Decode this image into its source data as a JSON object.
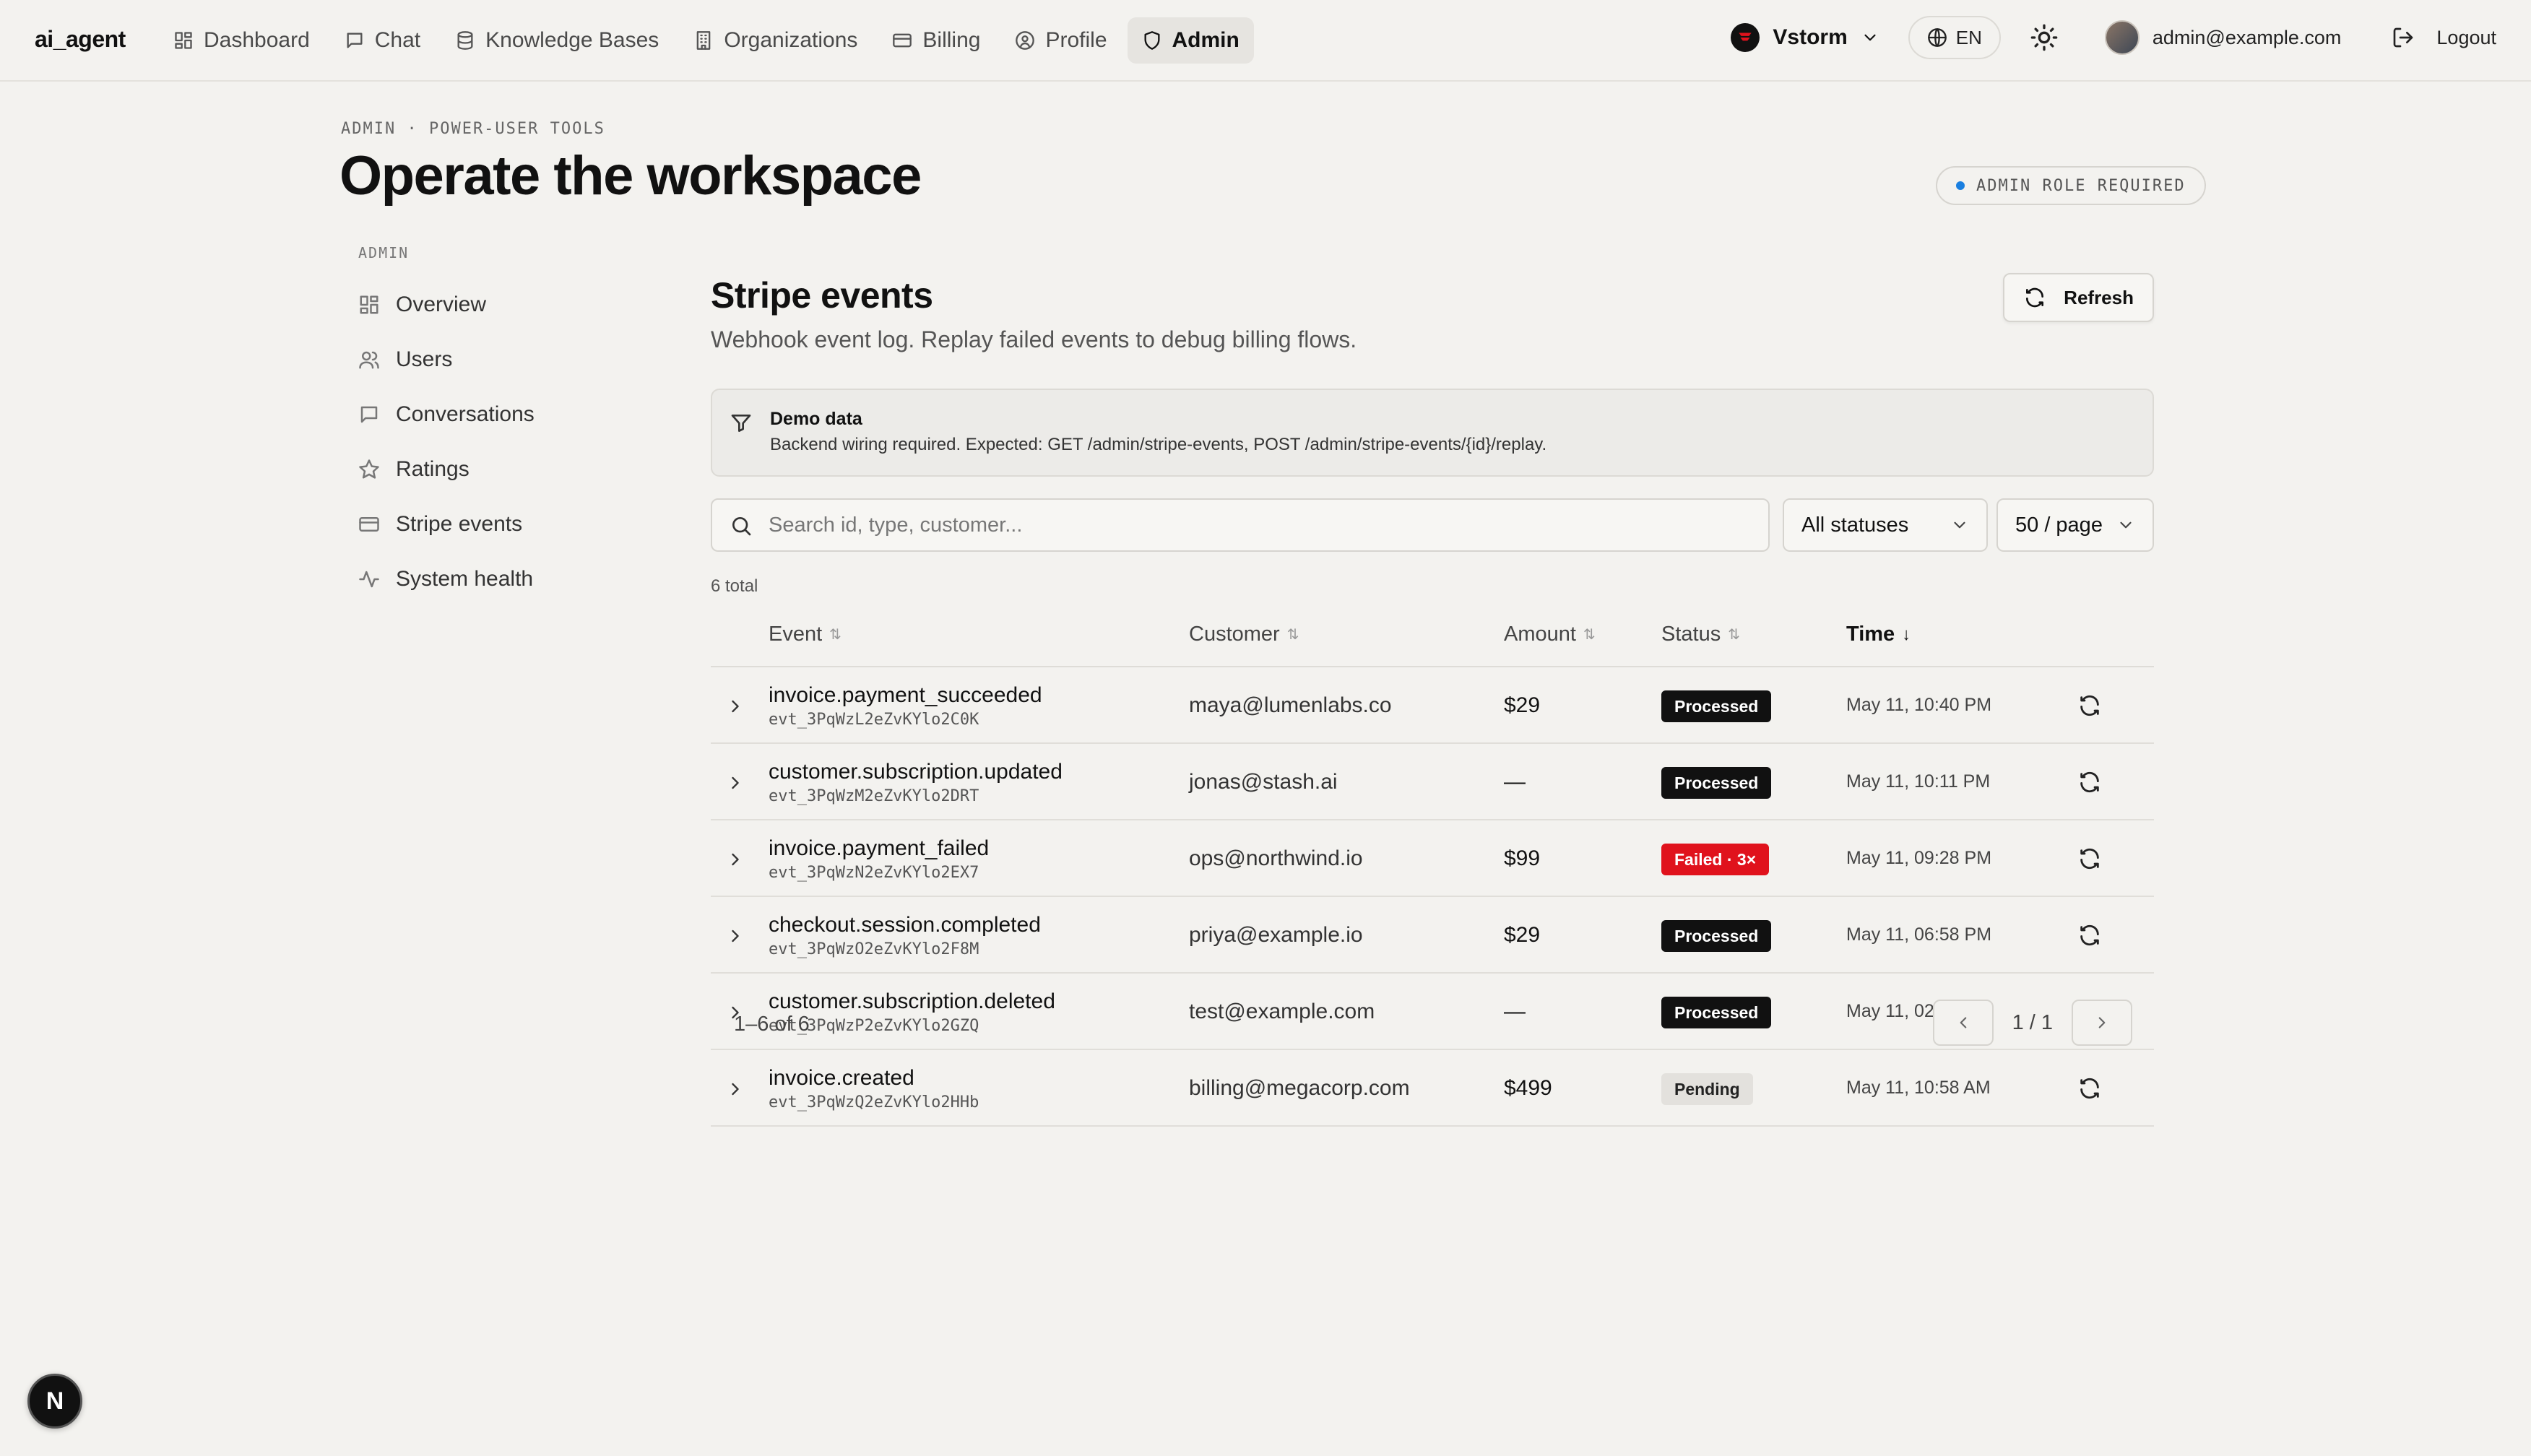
{
  "app": {
    "brand": "ai_agent"
  },
  "nav": {
    "items": [
      {
        "label": "Dashboard",
        "icon": "dashboard-icon",
        "active": false
      },
      {
        "label": "Chat",
        "icon": "chat-icon",
        "active": false
      },
      {
        "label": "Knowledge Bases",
        "icon": "database-icon",
        "active": false
      },
      {
        "label": "Organizations",
        "icon": "building-icon",
        "active": false
      },
      {
        "label": "Billing",
        "icon": "credit-card-icon",
        "active": false
      },
      {
        "label": "Profile",
        "icon": "user-circle-icon",
        "active": false
      },
      {
        "label": "Admin",
        "icon": "shield-icon",
        "active": true
      }
    ],
    "org": "Vstorm",
    "language": "EN",
    "user_email": "admin@example.com",
    "logout_label": "Logout"
  },
  "header": {
    "breadcrumb": "ADMIN · POWER-USER TOOLS",
    "title": "Operate the workspace",
    "role_badge": "ADMIN ROLE REQUIRED"
  },
  "sidebar": {
    "heading": "ADMIN",
    "items": [
      {
        "label": "Overview",
        "icon": "grid-icon"
      },
      {
        "label": "Users",
        "icon": "users-icon"
      },
      {
        "label": "Conversations",
        "icon": "message-icon"
      },
      {
        "label": "Ratings",
        "icon": "star-icon"
      },
      {
        "label": "Stripe events",
        "icon": "credit-card-icon"
      },
      {
        "label": "System health",
        "icon": "activity-icon"
      }
    ]
  },
  "main": {
    "title": "Stripe events",
    "subtitle": "Webhook event log. Replay failed events to debug billing flows.",
    "refresh_label": "Refresh",
    "demo": {
      "title": "Demo data",
      "text": "Backend wiring required. Expected: GET /admin/stripe-events, POST /admin/stripe-events/{id}/replay."
    },
    "search": {
      "placeholder": "Search id, type, customer...",
      "value": ""
    },
    "status_filter": "All statuses",
    "page_size": "50 / page",
    "total": "6 total",
    "columns": {
      "event": "Event",
      "customer": "Customer",
      "amount": "Amount",
      "status": "Status",
      "time": "Time"
    },
    "rows": [
      {
        "event": "invoice.payment_succeeded",
        "id": "evt_3PqWzL2eZvKYlo2C0K",
        "customer": "maya@lumenlabs.co",
        "amount": "$29",
        "status": "Processed",
        "status_kind": "processed",
        "time": "May 11, 10:40 PM"
      },
      {
        "event": "customer.subscription.updated",
        "id": "evt_3PqWzM2eZvKYlo2DRT",
        "customer": "jonas@stash.ai",
        "amount": "—",
        "status": "Processed",
        "status_kind": "processed",
        "time": "May 11, 10:11 PM"
      },
      {
        "event": "invoice.payment_failed",
        "id": "evt_3PqWzN2eZvKYlo2EX7",
        "customer": "ops@northwind.io",
        "amount": "$99",
        "status": "Failed · 3×",
        "status_kind": "failed",
        "time": "May 11, 09:28 PM"
      },
      {
        "event": "checkout.session.completed",
        "id": "evt_3PqWzO2eZvKYlo2F8M",
        "customer": "priya@example.io",
        "amount": "$29",
        "status": "Processed",
        "status_kind": "processed",
        "time": "May 11, 06:58 PM"
      },
      {
        "event": "customer.subscription.deleted",
        "id": "evt_3PqWzP2eZvKYlo2GZQ",
        "customer": "test@example.com",
        "amount": "—",
        "status": "Processed",
        "status_kind": "processed",
        "time": "May 11, 02:58 PM"
      },
      {
        "event": "invoice.created",
        "id": "evt_3PqWzQ2eZvKYlo2HHb",
        "customer": "billing@megacorp.com",
        "amount": "$499",
        "status": "Pending",
        "status_kind": "pending",
        "time": "May 11, 10:58 AM"
      }
    ],
    "pager": {
      "range": "1–6 of 6",
      "page": "1 / 1"
    }
  },
  "floating_badge": "N",
  "colors": {
    "background": "#f3f2ef",
    "failed": "#e0121c",
    "processed": "#111111",
    "accent_dot": "#1a7fe0"
  }
}
